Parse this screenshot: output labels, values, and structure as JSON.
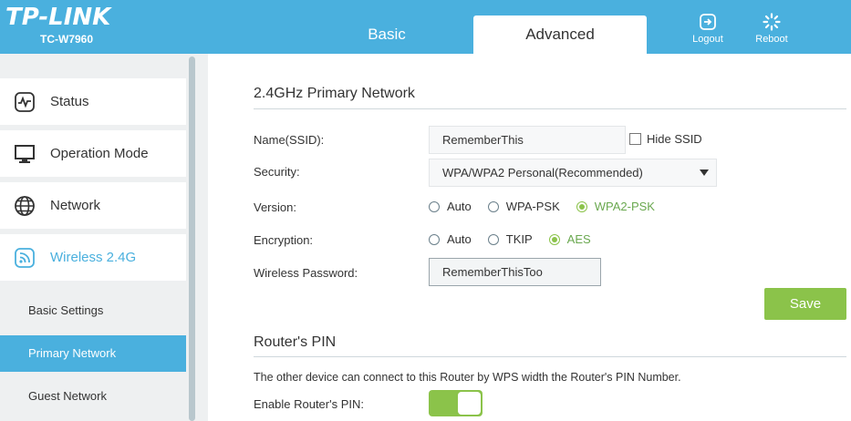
{
  "header": {
    "brand": "TP-LINK",
    "model": "TC-W7960",
    "tabs": [
      {
        "label": "Basic",
        "active": false
      },
      {
        "label": "Advanced",
        "active": true
      }
    ],
    "logout_label": "Logout",
    "reboot_label": "Reboot"
  },
  "sidebar": {
    "items": [
      {
        "label": "Status",
        "icon": "status-pulse-icon"
      },
      {
        "label": "Operation Mode",
        "icon": "monitor-icon"
      },
      {
        "label": "Network",
        "icon": "globe-icon"
      },
      {
        "label": "Wireless 2.4G",
        "icon": "wireless-icon",
        "active": true
      }
    ],
    "subitems": [
      {
        "label": "Basic Settings"
      },
      {
        "label": "Primary Network",
        "active": true
      },
      {
        "label": "Guest Network"
      }
    ]
  },
  "primary_network": {
    "title": "2.4GHz Primary Network",
    "ssid_label": "Name(SSID):",
    "ssid_value": "RememberThis",
    "hide_ssid_label": "Hide SSID",
    "hide_ssid_checked": false,
    "security_label": "Security:",
    "security_value": "WPA/WPA2 Personal(Recommended)",
    "version_label": "Version:",
    "version_options": [
      "Auto",
      "WPA-PSK",
      "WPA2-PSK"
    ],
    "version_selected": "WPA2-PSK",
    "encryption_label": "Encryption:",
    "encryption_options": [
      "Auto",
      "TKIP",
      "AES"
    ],
    "encryption_selected": "AES",
    "password_label": "Wireless Password:",
    "password_value": "RememberThisToo",
    "save_label": "Save"
  },
  "router_pin": {
    "title": "Router's PIN",
    "description": "The other device can connect to this Router by WPS width the Router's PIN Number.",
    "enable_label": "Enable Router's PIN:",
    "enabled": true
  },
  "colors": {
    "accent": "#4ab0de",
    "success": "#8bc34a"
  }
}
